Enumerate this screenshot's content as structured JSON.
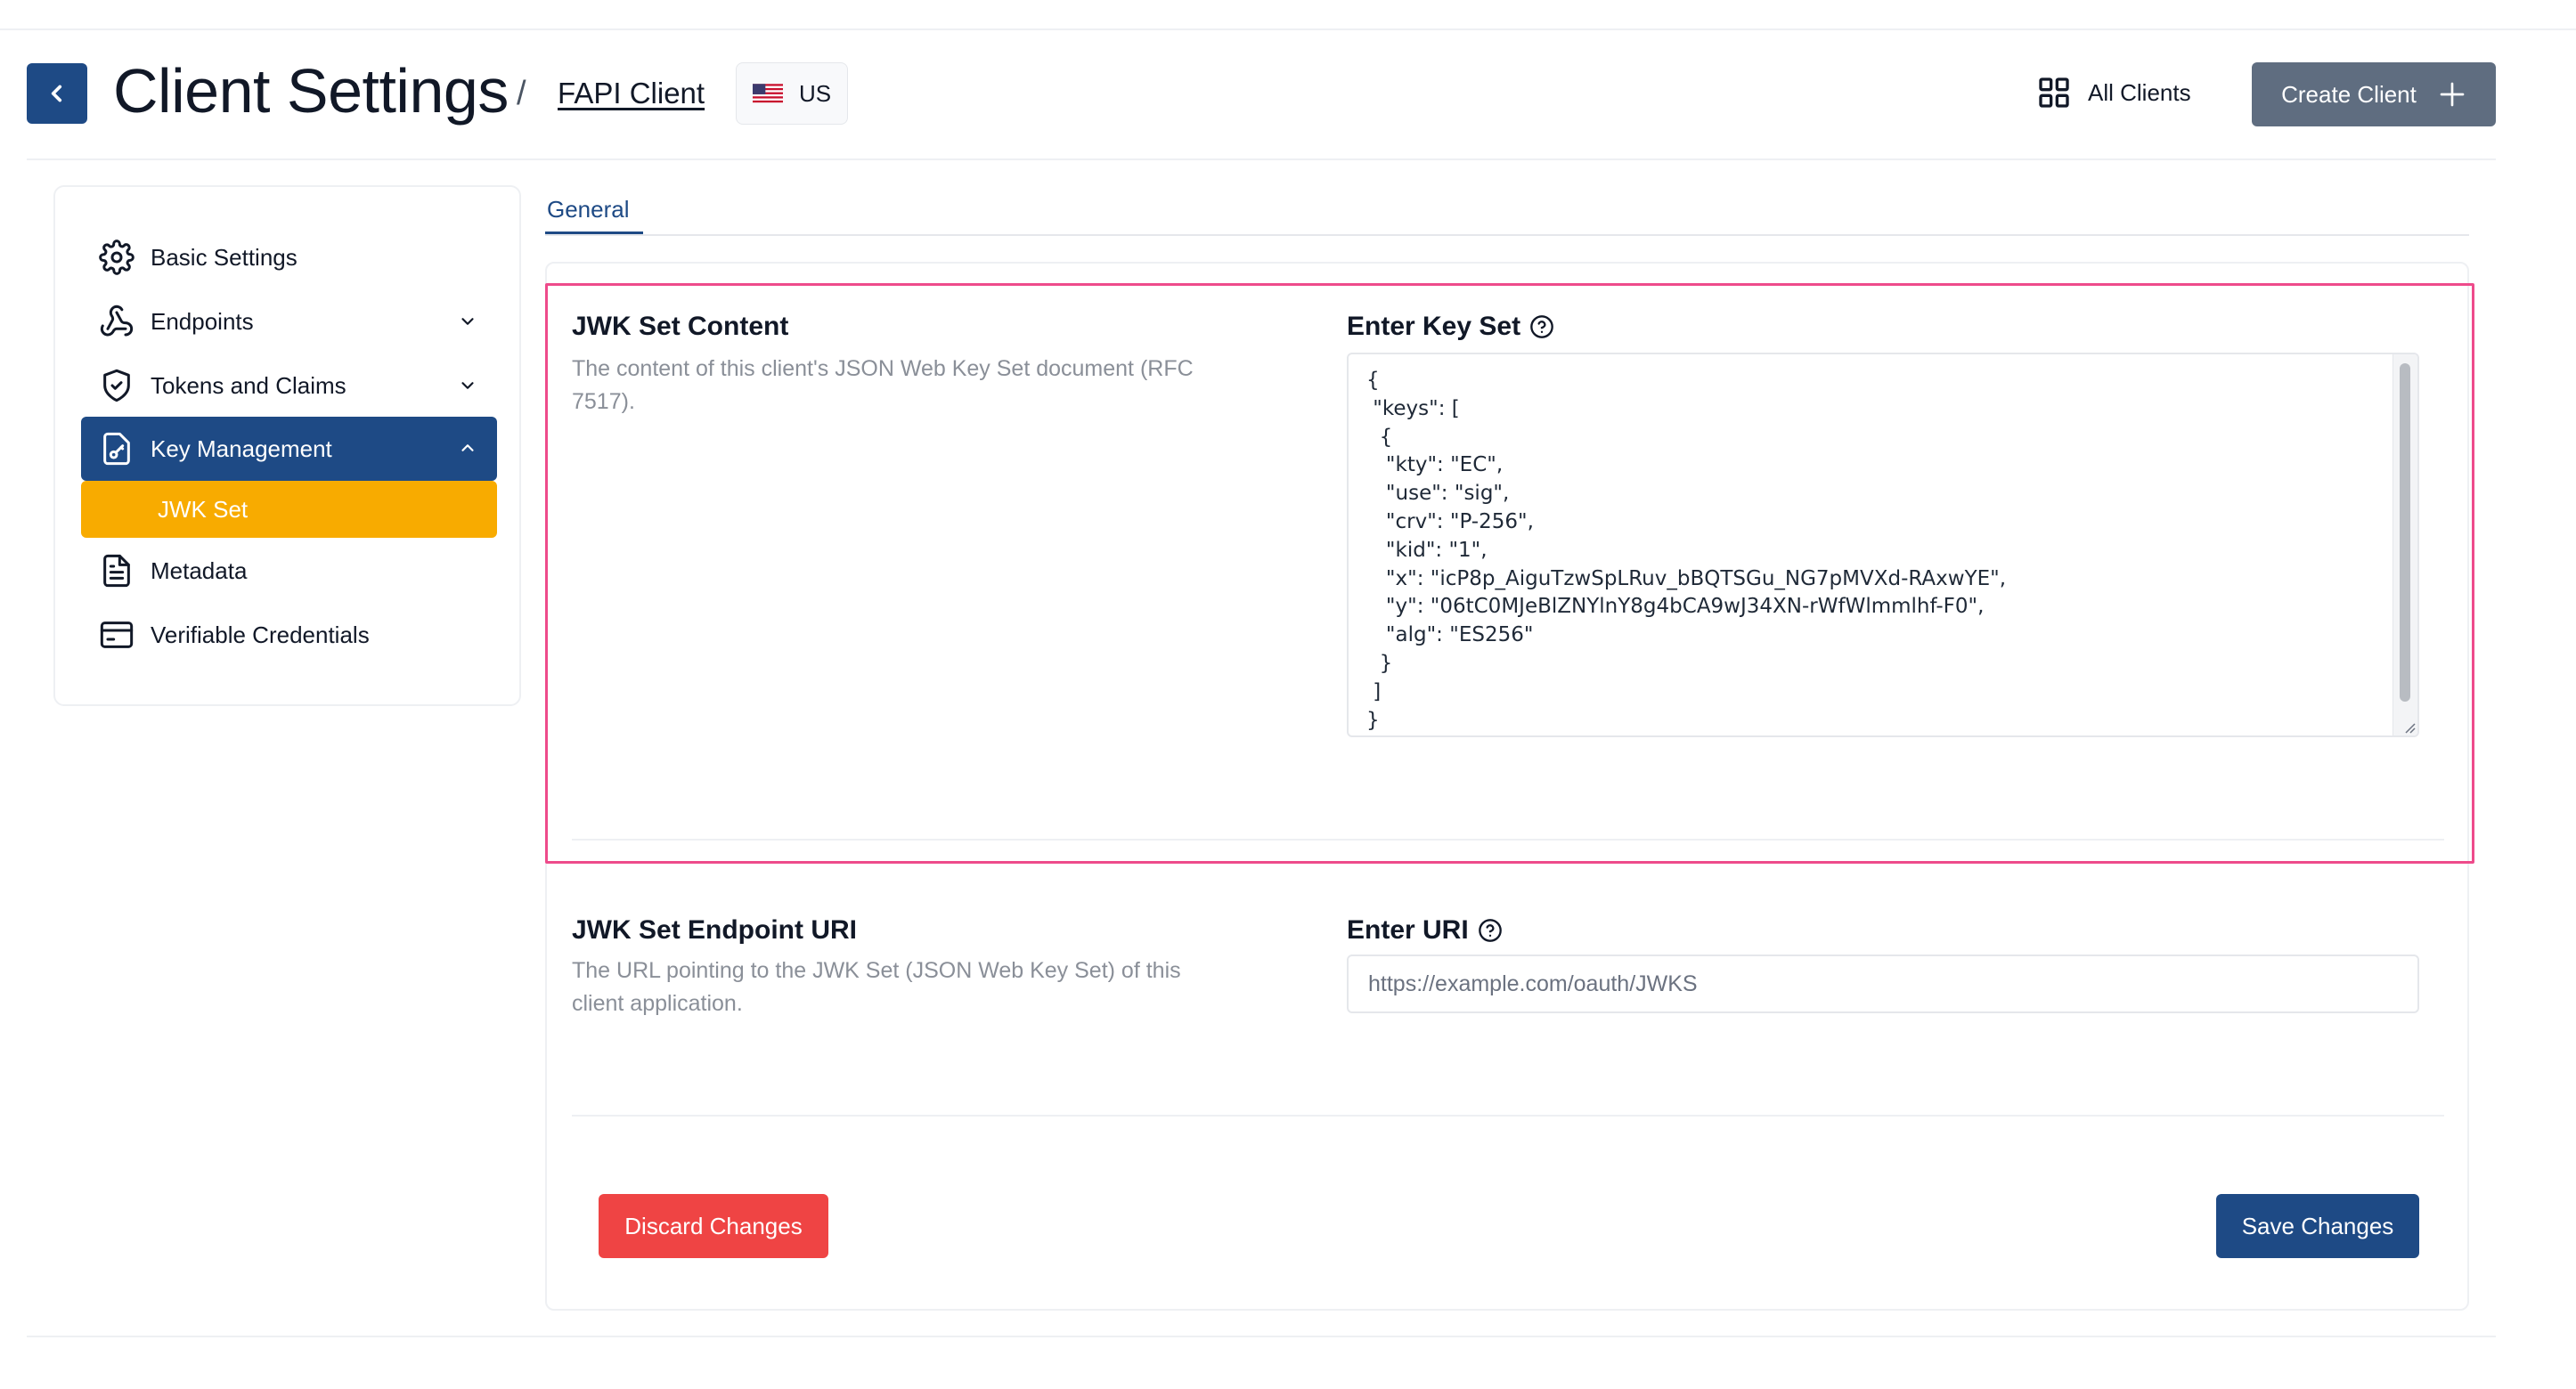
{
  "header": {
    "title": "Client Settings",
    "separator": "/",
    "breadcrumb_link": "FAPI Client",
    "region": {
      "code": "US",
      "icon": "us-flag-icon"
    },
    "all_clients_label": "All Clients",
    "create_client_label": "Create Client"
  },
  "sidebar": {
    "items": [
      {
        "label": "Basic Settings",
        "icon": "gear-icon"
      },
      {
        "label": "Endpoints",
        "icon": "webhook-icon",
        "expandable": true
      },
      {
        "label": "Tokens and Claims",
        "icon": "shield-check-icon",
        "expandable": true
      },
      {
        "label": "Key Management",
        "icon": "key-document-icon",
        "expanded": true,
        "active": true
      },
      {
        "label": "JWK Set",
        "sub": true,
        "active": true
      },
      {
        "label": "Metadata",
        "icon": "document-icon"
      },
      {
        "label": "Verifiable Credentials",
        "icon": "credential-icon"
      }
    ]
  },
  "tabs": [
    {
      "label": "General",
      "active": true
    }
  ],
  "jwks_content": {
    "title": "JWK Set Content",
    "description": "The content of this client's JSON Web Key Set document (RFC 7517).",
    "field_label": "Enter Key Set",
    "value": "{\n \"keys\": [\n  {\n   \"kty\": \"EC\",\n   \"use\": \"sig\",\n   \"crv\": \"P-256\",\n   \"kid\": \"1\",\n   \"x\": \"icP8p_AiguTzwSpLRuv_bBQTSGu_NG7pMVXd-RAxwYE\",\n   \"y\": \"06tC0MJeBlZNYlnY8g4bCA9wJ34XN-rWfWlmmlhf-F0\",\n   \"alg\": \"ES256\"\n  }\n ]\n}"
  },
  "jwks_uri": {
    "title": "JWK Set Endpoint URI",
    "description": "The URL pointing to the JWK Set (JSON Web Key Set) of this client application.",
    "field_label": "Enter URI",
    "placeholder": "https://example.com/oauth/JWKS"
  },
  "actions": {
    "discard_label": "Discard Changes",
    "save_label": "Save Changes"
  },
  "colors": {
    "primary": "#1e4a85",
    "accent_active_sub": "#f8ab00",
    "danger": "#ef4444",
    "create_button": "#5f6d80",
    "highlight_border": "#ee4b8b"
  }
}
